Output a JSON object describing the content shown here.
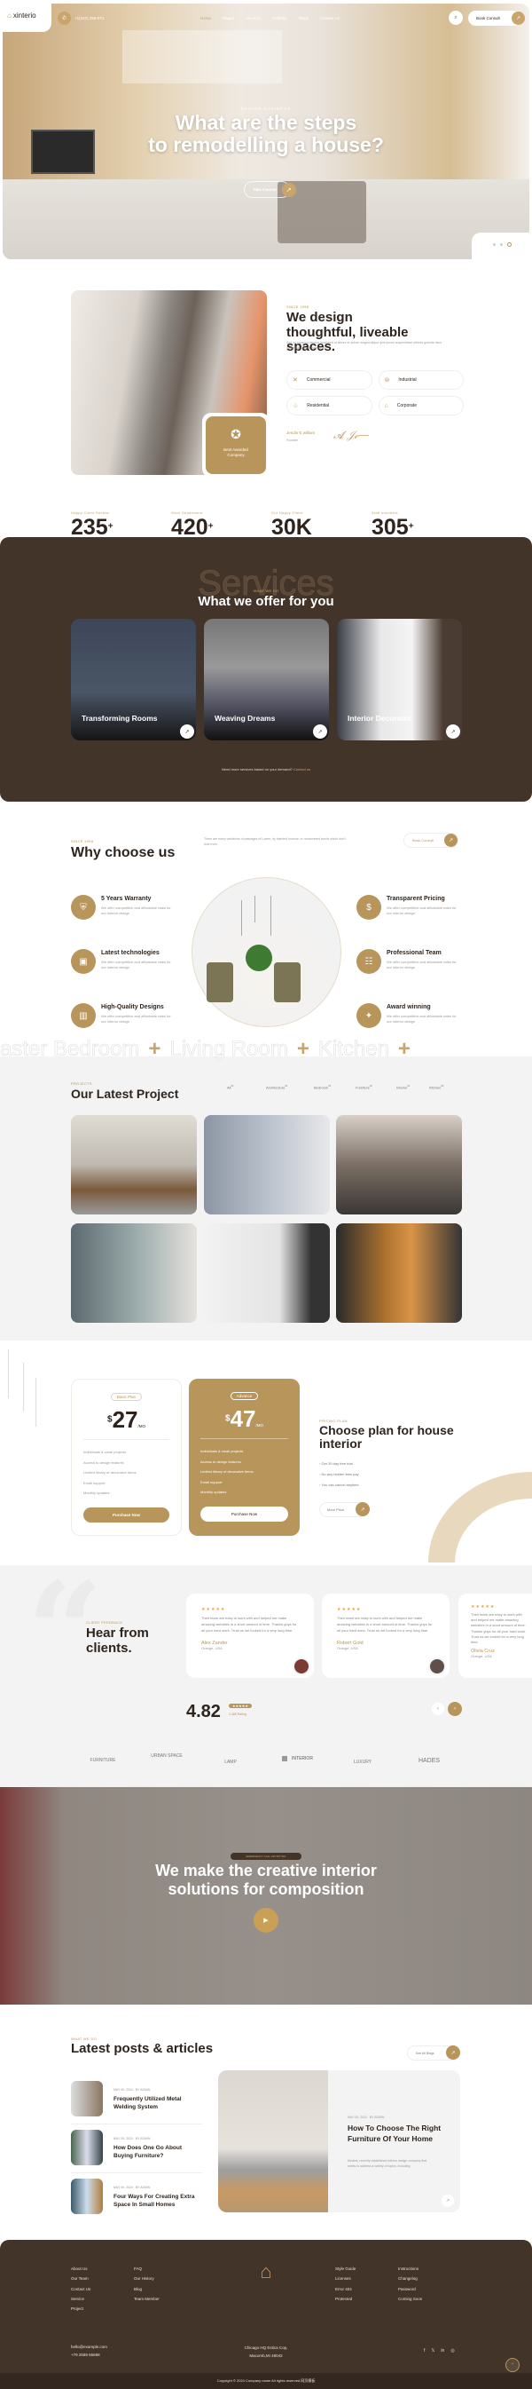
{
  "colors": {
    "accent": "#b8955a",
    "dark": "#43342a",
    "light_bg": "#f3f3f3"
  },
  "header": {
    "logo": "xinterio",
    "phone": "+1(310) 255-071",
    "nav": [
      "Home",
      "Pages",
      "Services",
      "Portfolio",
      "Blogs",
      "Contact Us"
    ],
    "book": "Book Consult",
    "search_icon": "search-icon"
  },
  "hero": {
    "tag": "DESIGN BUSINESS",
    "title_line1": "What are the steps",
    "title_line2": "to remodelling a house?",
    "cta": "Take Course",
    "slides": 3,
    "active_slide": 3
  },
  "about": {
    "tag": "SINCE 1998",
    "title": "We design thoughtful, liveable spaces.",
    "text": "Sed do eiusmod tempor incididunt ut labore et dolore magna aliqua quis ipsum suspendisse ultrices gravida risus commodo viverra maecenas.",
    "badge": "Best Awarded Company",
    "categories": [
      "Commercial",
      "Industrial",
      "Residential",
      "Corporate"
    ],
    "founder_name": "Jendin E william",
    "founder_role": "Founder",
    "stats": [
      {
        "label": "Happy Client Review",
        "value": "235",
        "suffix": "+"
      },
      {
        "label": "Work Department",
        "value": "420",
        "suffix": "+"
      },
      {
        "label": "Our Happy Client",
        "value": "30K",
        "suffix": ""
      },
      {
        "label": "Staff members",
        "value": "305",
        "suffix": "+"
      }
    ]
  },
  "services": {
    "bg_word": "Services",
    "tag": "WHAT WE DO",
    "title": "What we offer for you",
    "cards": [
      "Transforming Rooms",
      "Weaving Dreams",
      "Interior Decorator"
    ],
    "note": "Need more services based on your demand?",
    "note_link": "Contact us"
  },
  "why": {
    "tag": "SINCE 1998",
    "title": "Why choose us",
    "intro": "There are many variations of passages of Lorem, by injected humour, or randomised words which don't look even.",
    "button": "Book Consult",
    "features": [
      {
        "title": "5 Years Warranty",
        "text": "We offer competitive and affordable rates for our interior design"
      },
      {
        "title": "Latest technologies",
        "text": "We offer competitive and affordable rates for our interior design"
      },
      {
        "title": "High-Quality Designs",
        "text": "We offer competitive and affordable rates for our interior design"
      },
      {
        "title": "Transparent Pricing",
        "text": "We offer competitive and affordable rates for our interior design"
      },
      {
        "title": "Professional Team",
        "text": "We offer competitive and affordable rates for our interior design"
      },
      {
        "title": "Award winning",
        "text": "We offer competitive and affordable rates for our interior design"
      }
    ]
  },
  "marquee": [
    "aster Bedroom",
    "Living Room",
    "Kitchen"
  ],
  "projects": {
    "tag": "PROJECTS",
    "title": "Our Latest Project",
    "filters": [
      {
        "label": "All",
        "count": "06"
      },
      {
        "label": "Architecture",
        "count": "02"
      },
      {
        "label": "Bedroom",
        "count": "03"
      },
      {
        "label": "Furniture",
        "count": "02"
      },
      {
        "label": "Interior",
        "count": "01"
      },
      {
        "label": "Kitchen",
        "count": "03"
      }
    ]
  },
  "pricing": {
    "tag": "PRICING PLAN",
    "title": "Choose plan for house interior",
    "points": [
      "Get 30 day free trial",
      "No any hidden fees pay",
      "You can cancel anytime"
    ],
    "more": "More Price",
    "plans": [
      {
        "name": "Basic Plan",
        "currency": "$",
        "price": "27",
        "period": "/MO",
        "features": [
          "Individuals & small projects",
          "Access to design features",
          "Limited library of decorative items",
          "Email support",
          "Monthly updates"
        ],
        "button": "Purchase Now"
      },
      {
        "name": "Advance",
        "currency": "$",
        "price": "47",
        "period": "/MO",
        "features": [
          "Individuals & small projects",
          "Access to design features",
          "Limited library of decorative items",
          "Email support",
          "Monthly updates"
        ],
        "button": "Purchase Now"
      }
    ]
  },
  "testimonials": {
    "tag": "CLIENT FEEDBACK",
    "title": "Hear from clients.",
    "items": [
      {
        "stars": "★★★★★",
        "text": "Their team are easy to work with and helped me make amazing websites in a short amount of time. Thanks guys for all your hard work. Trust us we looked for a very long time.",
        "name": "Alex Zander",
        "loc": "Orange, USA"
      },
      {
        "stars": "★★★★★",
        "text": "Their team are easy to work with and helped me make amazing websites in a short amount of time. Thanks guys for all your hard work. Trust us we looked for a very long time.",
        "name": "Robert Gold",
        "loc": "Orange, USA"
      },
      {
        "stars": "★★★★★",
        "text": "Their team are easy to work with and helped me make amazing websites in a short amount of time. Thanks guys for all your hard work. Trust us we looked for a very long time.",
        "name": "Olivia Cruz",
        "loc": "Orange, USA"
      }
    ],
    "rating": "4.82",
    "rating_stars": "★★★★★",
    "rating_count": "2,488 Rating",
    "logos": [
      "FURNITURE",
      "URBAN SPACE",
      "LAMP",
      "INTERIOR",
      "LUXURY",
      "HADES"
    ]
  },
  "cta": {
    "tag": "EMERGENCY CALL 315 687 561",
    "title_line1": "We make the creative interior",
    "title_line2": "solutions for composition"
  },
  "blog": {
    "tag": "WHAT WE DO",
    "title": "Latest posts & articles",
    "button": "See All Blogs",
    "posts": [
      {
        "date": "MAY 09, 2024",
        "author": "BY ADMIN",
        "title": "Frequently Utilized Metal Welding System"
      },
      {
        "date": "MAY 09, 2024",
        "author": "BY ADMIN",
        "title": "How Does One Go About Buying Furniture?"
      },
      {
        "date": "MAY 09, 2024",
        "author": "BY ADMIN",
        "title": "Four Ways For Creating Extra Space In Small Homes"
      }
    ],
    "featured": {
      "date": "MAY 09, 2024",
      "author": "BY ADMIN",
      "title": "How To Choose The Right Furniture Of Your Home",
      "text": "Modest, recently established interior design company that seeks to address a variety of topics, including"
    }
  },
  "footer": {
    "col1": [
      "About Us",
      "Our Team",
      "Contact Us",
      "Service",
      "Project"
    ],
    "col2": [
      "FAQ",
      "Our History",
      "Blog",
      "Team Member"
    ],
    "col3": [
      "Style Guide",
      "Licenses",
      "Error 404",
      "Protected"
    ],
    "col4": [
      "Instructions",
      "Changelog",
      "Password",
      "Coming Soon"
    ],
    "email": "hello@example.com",
    "phone": "+79 2589 65698",
    "address1": "Chicago HQ Estica Cop,",
    "address2": "Macomb,MI 48042",
    "social": [
      "facebook-icon",
      "x-icon",
      "linkedin-icon",
      "instagram-icon"
    ],
    "copyright": "Copyright © 2024 Company name All rights reserved.网页模板"
  }
}
